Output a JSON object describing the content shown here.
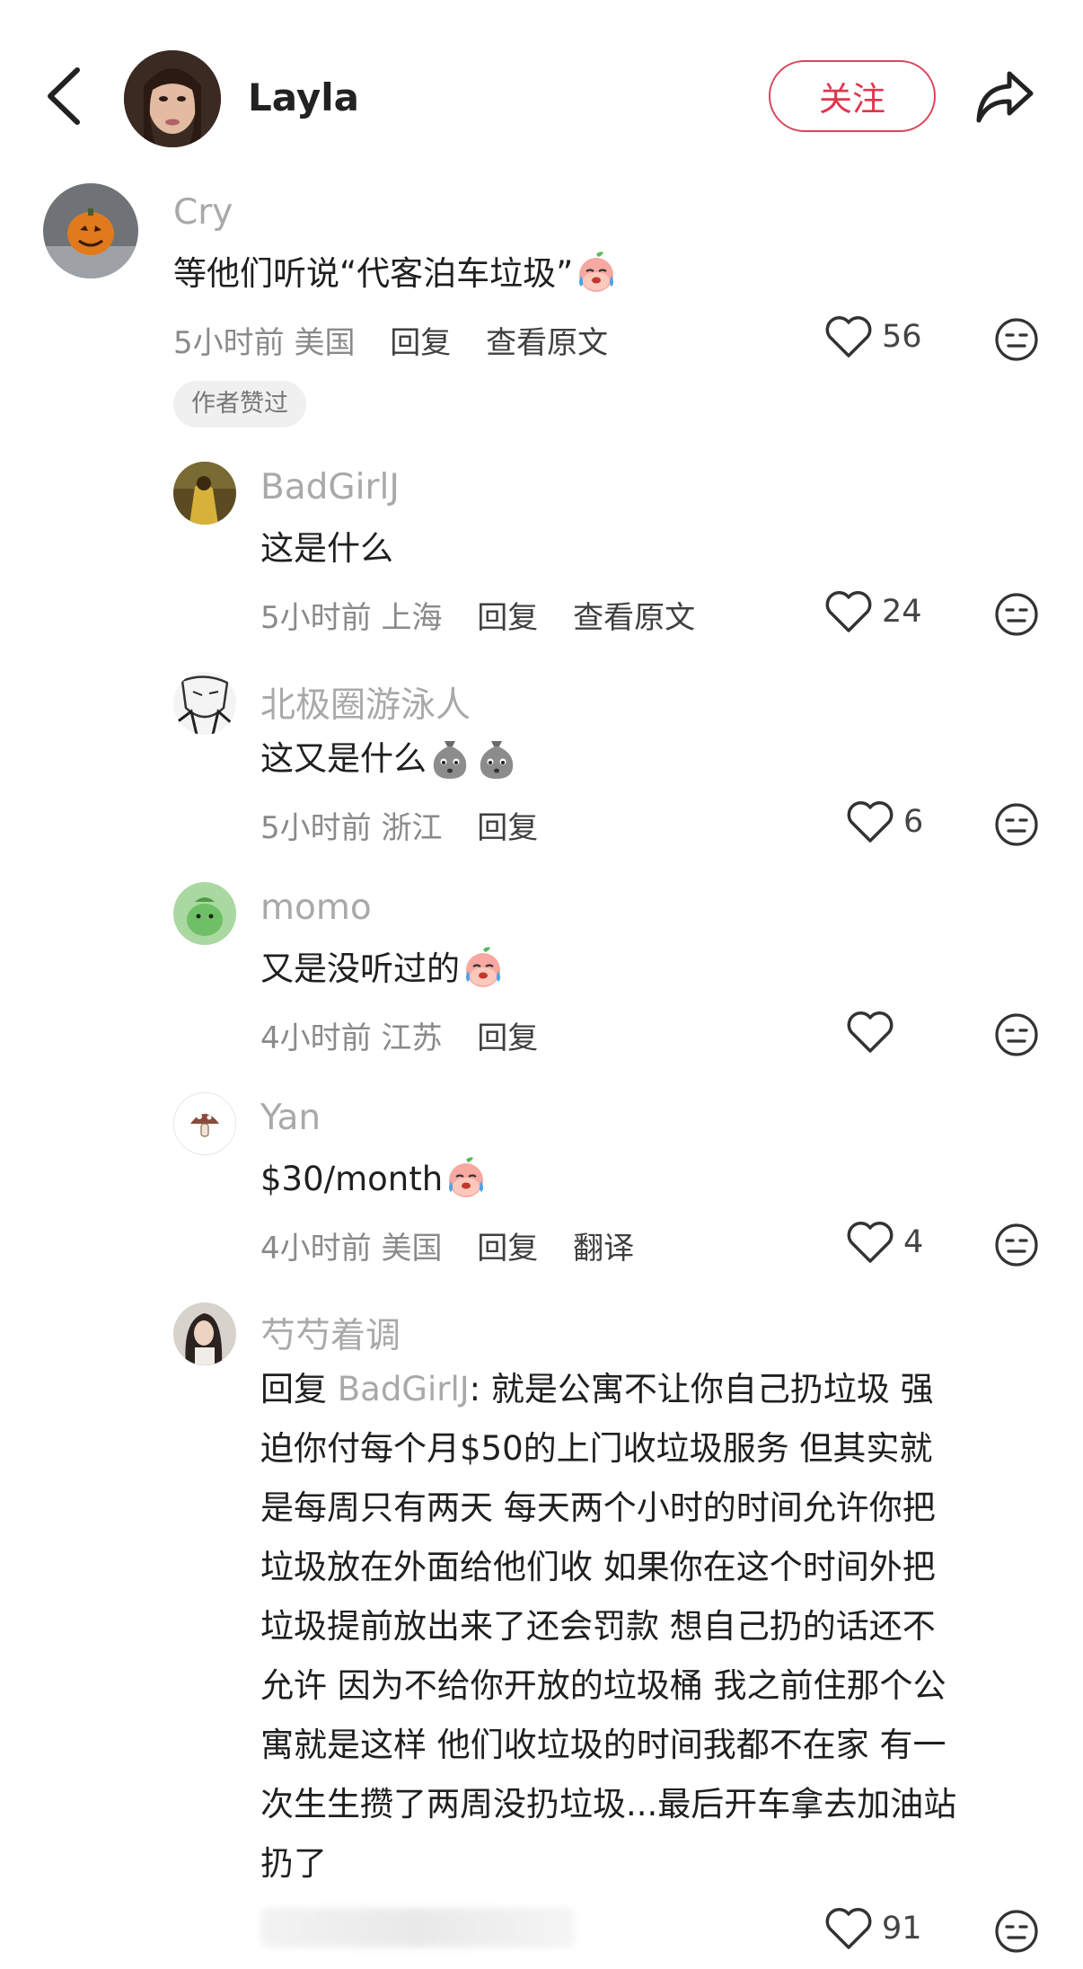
{
  "header": {
    "username": "Layla",
    "follow_label": "关注"
  },
  "comments": [
    {
      "user": "Cry",
      "text": "等他们听说“代客泊车垃圾”",
      "time": "5小时前",
      "location": "美国",
      "reply_label": "回复",
      "extra_label": "查看原文",
      "likes": "56",
      "badge": "作者赞过"
    },
    {
      "user": "BadGirlJ",
      "text": "这是什么",
      "time": "5小时前",
      "location": "上海",
      "reply_label": "回复",
      "extra_label": "查看原文",
      "likes": "24"
    },
    {
      "user": "北极圈游泳人",
      "text": "这又是什么",
      "time": "5小时前",
      "location": "浙江",
      "reply_label": "回复",
      "likes": "6"
    },
    {
      "user": "momo",
      "text": "又是没听过的",
      "time": "4小时前",
      "location": "江苏",
      "reply_label": "回复",
      "likes": ""
    },
    {
      "user": "Yan",
      "text": "$30/month",
      "time": "4小时前",
      "location": "美国",
      "reply_label": "回复",
      "extra_label": "翻译",
      "likes": "4"
    },
    {
      "user": "芍芍着调",
      "reply_prefix": "回复",
      "reply_target": "BadGirlJ",
      "lines": [
        ": 就是公寓不让你自己扔垃圾 强",
        "迫你付每个月$50的上门收垃圾服务 但其实就",
        "是每周只有两天 每天两个小时的时间允许你把",
        "垃圾放在外面给他们收 如果你在这个时间外把",
        "垃圾提前放出来了还会罚款 想自己扔的话还不",
        "允许 因为不给你开放的垃圾桶 我之前住那个公",
        "寓就是这样 他们收垃圾的时间我都不在家 有一",
        "次生生攒了两周没扔垃圾...最后开车拿去加油站",
        "扔了"
      ],
      "likes": "91"
    }
  ],
  "icons": {
    "back": "chevron-left-icon",
    "share": "share-arrow-icon",
    "like": "heart-outline-icon",
    "dislike": "meh-face-icon",
    "emoji_cry": "crying-peach-emoji",
    "emoji_bag": "gray-bag-emoji"
  },
  "colors": {
    "accent": "#e0354e",
    "username_gray": "#a9a9a9",
    "meta_gray": "#8a8a8a"
  }
}
